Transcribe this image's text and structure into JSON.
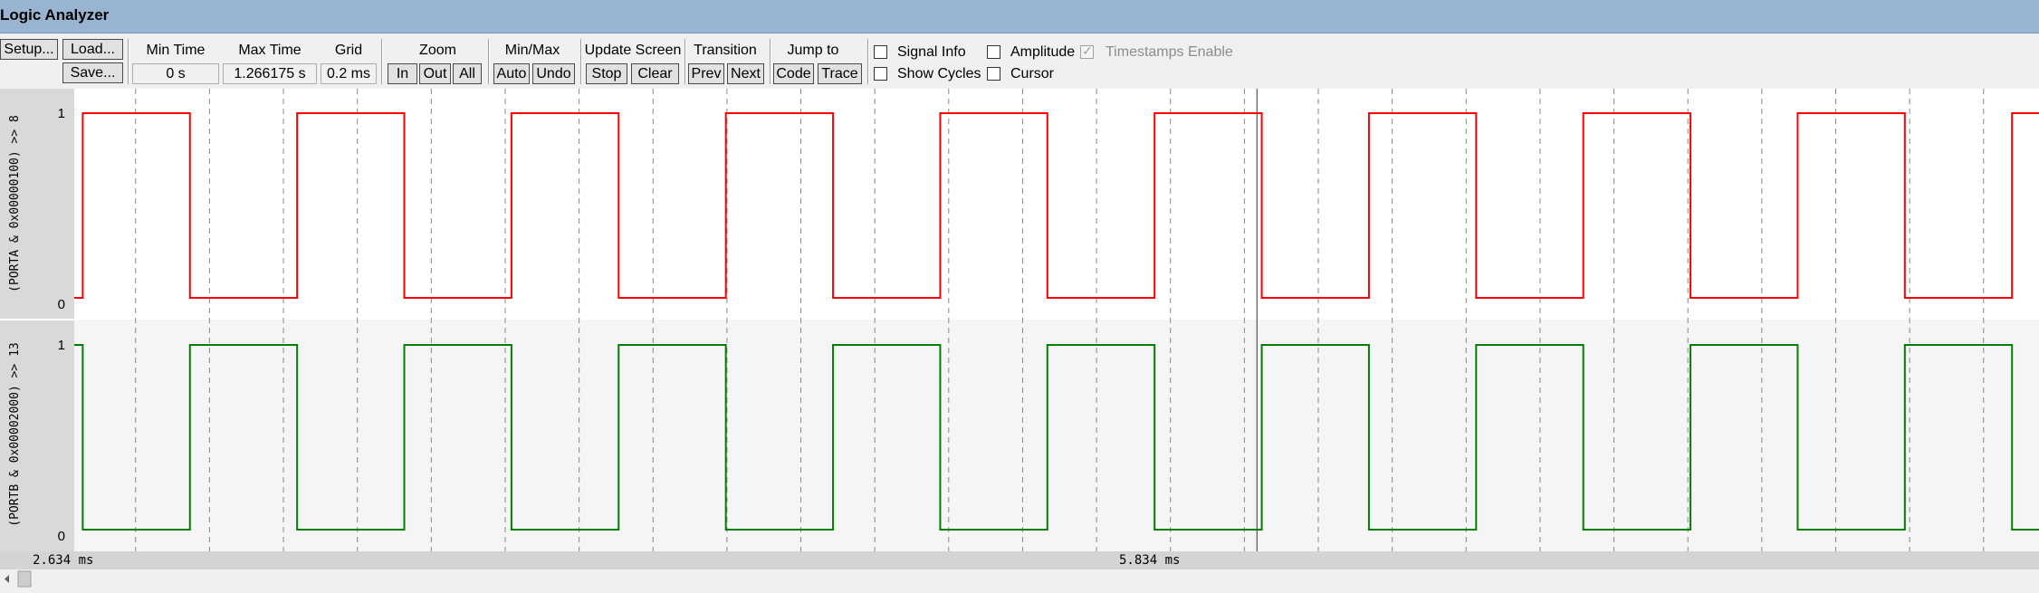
{
  "window": {
    "title": "Logic Analyzer"
  },
  "toolbar": {
    "setup_label": "Setup...",
    "load_label": "Load...",
    "save_label": "Save...",
    "min_time_label": "Min Time",
    "min_time_value": "0 s",
    "max_time_label": "Max Time",
    "max_time_value": "1.266175 s",
    "grid_label": "Grid",
    "grid_value": "0.2 ms",
    "zoom_label": "Zoom",
    "zoom_in": "In",
    "zoom_out": "Out",
    "zoom_all": "All",
    "minmax_label": "Min/Max",
    "minmax_auto": "Auto",
    "minmax_undo": "Undo",
    "update_label": "Update Screen",
    "update_stop": "Stop",
    "update_clear": "Clear",
    "transition_label": "Transition",
    "transition_prev": "Prev",
    "transition_next": "Next",
    "jump_label": "Jump to",
    "jump_code": "Code",
    "jump_trace": "Trace",
    "signal_info_label": "Signal Info",
    "show_cycles_label": "Show Cycles",
    "amplitude_label": "Amplitude",
    "cursor_label": "Cursor",
    "timestamps_label": "Timestamps Enable"
  },
  "signals": [
    {
      "name": "(PORTA & 0x00000100) >> 8",
      "color": "#ff0000",
      "y_max_label": "1",
      "y_min_label": "0",
      "initial_level": 0
    },
    {
      "name": "(PORTB & 0x00002000) >> 13",
      "color": "#008000",
      "y_max_label": "1",
      "y_min_label": "0",
      "initial_level": 1
    }
  ],
  "timeline": {
    "start_ms": 2.634,
    "end_ms": 7.95,
    "cursor_ms": 5.834,
    "transition_times_ms": [
      2.657,
      2.947,
      3.237,
      3.527,
      3.817,
      4.107,
      4.397,
      4.687,
      4.977,
      5.267,
      5.557,
      5.847,
      6.137,
      6.427,
      6.717,
      7.007,
      7.297,
      7.587,
      7.877
    ],
    "grid_start_ms": 2.8,
    "grid_step_ms": 0.2,
    "left_label": "2.634 ms",
    "cursor_label": "5.834 ms"
  }
}
